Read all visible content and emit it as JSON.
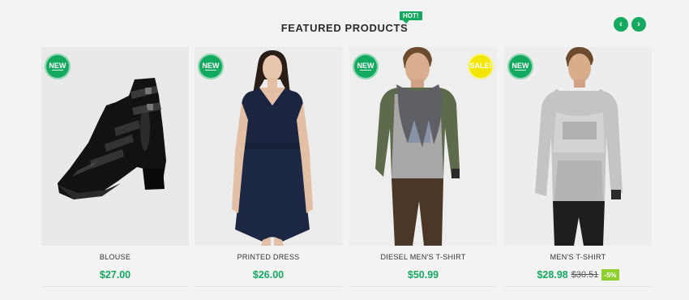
{
  "section": {
    "title": "FEATURED PRODUCTS",
    "hot_badge": "HOT!",
    "prev_label": "‹",
    "next_label": "›"
  },
  "colors": {
    "accent": "#13a95e",
    "sale_badge": "#f2e600",
    "discount_badge": "#8ecf2d",
    "background": "#f3f3f3"
  },
  "products": [
    {
      "name": "BLOUSE",
      "price": "$27.00",
      "badge": "NEW",
      "image_icon": "black-heeled-boot"
    },
    {
      "name": "PRINTED DRESS",
      "price": "$26.00",
      "badge": "NEW",
      "image_icon": "woman-in-navy-dress"
    },
    {
      "name": "DIESEL MEN'S T-SHIRT",
      "price": "$50.99",
      "badge": "NEW",
      "sale_badge": "SALE!",
      "image_icon": "man-in-scarf-and-tshirt"
    },
    {
      "name": "MEN'S T-SHIRT",
      "price": "$28.98",
      "old_price": "$30.51",
      "discount": "-5%",
      "badge": "NEW",
      "image_icon": "man-in-grey-hoodie"
    }
  ]
}
